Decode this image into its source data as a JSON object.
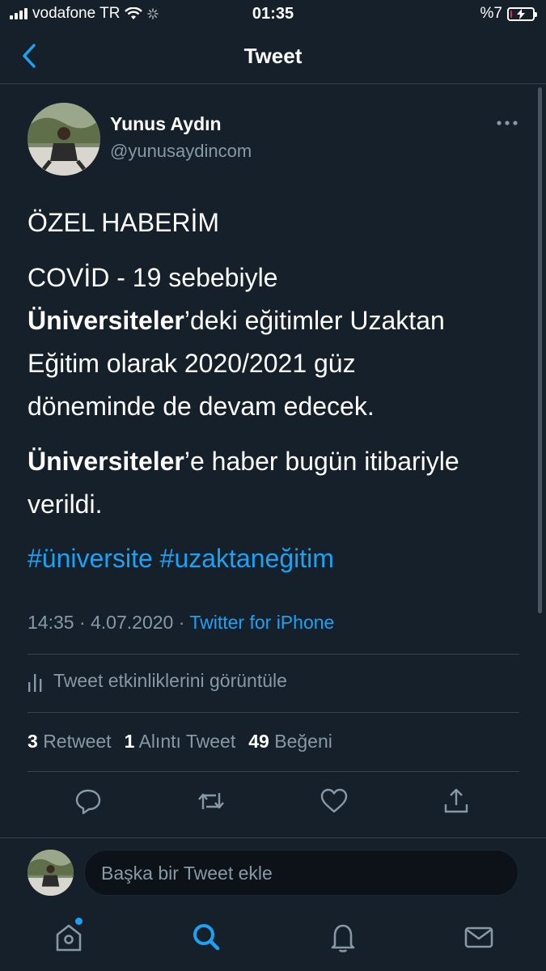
{
  "status_bar": {
    "carrier": "vodafone TR",
    "time": "01:35",
    "battery_text": "%7",
    "battery_level": 0.07
  },
  "header": {
    "title": "Tweet",
    "back_icon": "chevron-left-icon"
  },
  "tweet": {
    "author_name": "Yunus Aydın",
    "author_handle": "@yunusaydincom",
    "paragraph_1": "ÖZEL HABERİM",
    "paragraph_2_line_1": "COVİD - 19 sebebiyle",
    "paragraph_2_bold": "Üniversiteler",
    "paragraph_2_rest_1": "’deki eğitimler Uzaktan",
    "paragraph_2_line_3": "Eğitim olarak 2020/2021 güz",
    "paragraph_2_line_4": "döneminde de devam edecek.",
    "paragraph_3_bold": "Üniversiteler",
    "paragraph_3_rest_1": "’e haber bugün itibariyle",
    "paragraph_3_line_2": "verildi.",
    "hashtags": "#üniversite #uzaktaneğitim",
    "timestamp": "14:35 · 4.07.2020 · ",
    "source": "Twitter for iPhone",
    "activity_label": "Tweet etkinliklerini görüntüle",
    "retweet_count": "3",
    "retweet_label": "Retweet",
    "quote_count": "1",
    "quote_label": "Alıntı Tweet",
    "like_count": "49",
    "like_label": "Beğeni"
  },
  "reply": {
    "placeholder": "Başka bir Tweet ekle"
  },
  "tabs": [
    "home-icon",
    "search-icon",
    "notifications-icon",
    "messages-icon"
  ],
  "colors": {
    "background": "#15202b",
    "accent": "#1da1f2",
    "secondary_text": "#8899a6",
    "divider": "#38444d"
  }
}
